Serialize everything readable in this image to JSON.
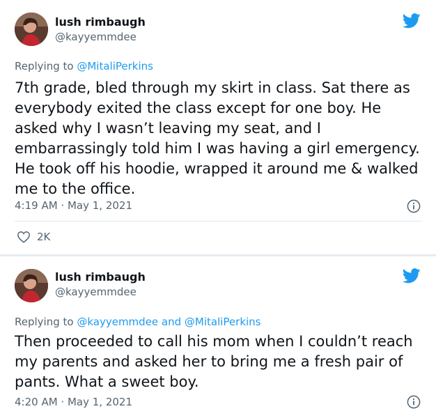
{
  "colors": {
    "accent": "#1d9bf0",
    "text": "#0f1419",
    "secondary": "#536471",
    "separator": "#e6ecf0"
  },
  "tweets": [
    {
      "author": {
        "name": "lush rimbaugh",
        "handle": "@kayyemmdee",
        "avatar_icon": "avatar-photo"
      },
      "reply_prefix": "Replying to ",
      "reply_mentions": "@MitaliPerkins",
      "text": "7th grade, bled through my skirt in class. Sat there as everybody exited the class except for one boy. He asked why I wasn’t leaving my seat, and I embarrassingly told him I was having a girl emergency. He took off his hoodie, wrapped it around me & walked me to the office.",
      "time": "4:19 AM",
      "separator": " · ",
      "date": "May 1, 2021",
      "likes": "2K",
      "icons": [
        "twitter-bird-icon",
        "info-icon",
        "heart-icon"
      ]
    },
    {
      "author": {
        "name": "lush rimbaugh",
        "handle": "@kayyemmdee",
        "avatar_icon": "avatar-photo"
      },
      "reply_prefix": "Replying to ",
      "reply_mentions": "@kayyemmdee and @MitaliPerkins",
      "text": "Then proceeded to call his mom when I couldn’t reach my parents and asked her to bring me a fresh pair of pants. What a sweet boy.",
      "time": "4:20 AM",
      "separator": " · ",
      "date": "May 1, 2021",
      "icons": [
        "twitter-bird-icon",
        "info-icon"
      ]
    }
  ]
}
